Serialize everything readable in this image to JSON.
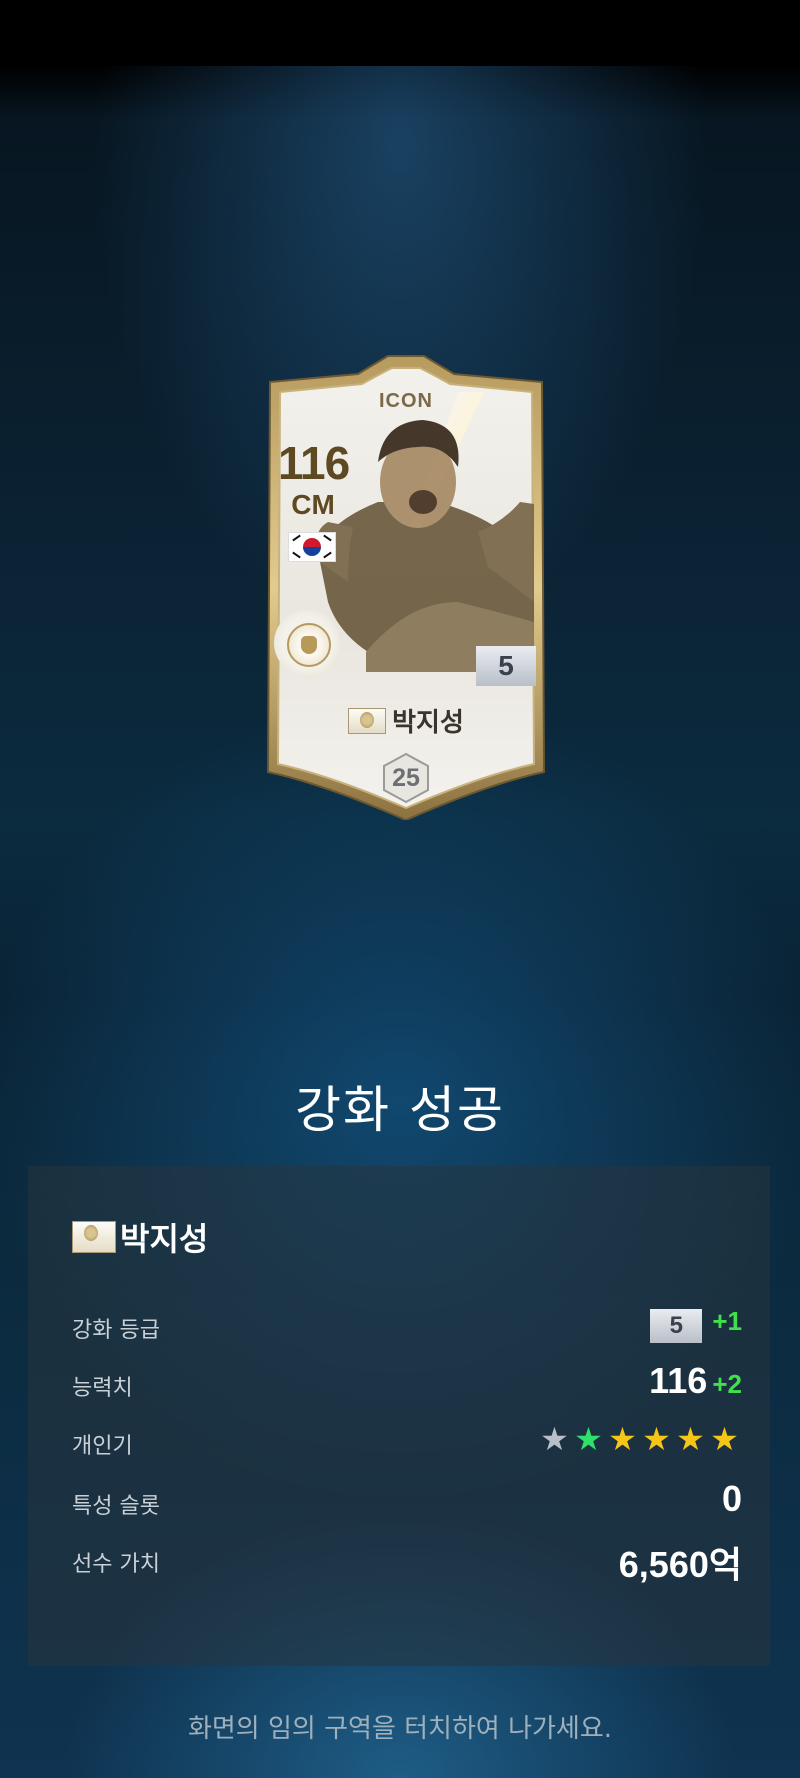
{
  "card": {
    "label": "ICON",
    "ovr": "116",
    "position": "CM",
    "grade": "5",
    "name": "박지성",
    "level": "25",
    "nation": "south-korea-flag",
    "club_emblem": "icon-club-emblem"
  },
  "result": {
    "title": "강화 성공",
    "player_name": "박지성",
    "rows": {
      "grade": {
        "label": "강화 등급",
        "value": "5",
        "delta": "+1"
      },
      "ovr": {
        "label": "능력치",
        "value": "116",
        "delta": "+2"
      },
      "popularity": {
        "label": "개인기",
        "stars": [
          "★",
          "★",
          "★",
          "★",
          "★",
          "★"
        ],
        "star_colors": [
          "#b9bfc8",
          "#2fe06b",
          "#f5c518",
          "#f5c518",
          "#f5c518",
          "#f5c518"
        ]
      },
      "trait_slots": {
        "label": "특성 슬롯",
        "value": "0"
      },
      "player_value": {
        "label": "선수 가치",
        "value": "6,560억"
      }
    }
  },
  "hint": "화면의 임의 구역을 터치하여 나가세요."
}
